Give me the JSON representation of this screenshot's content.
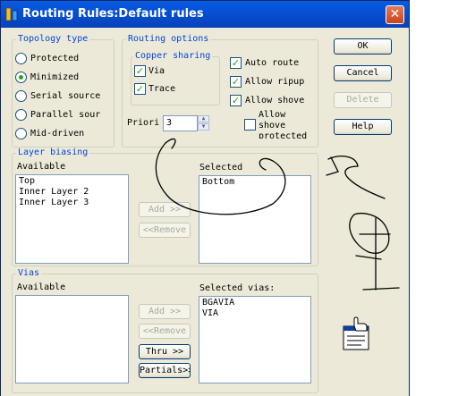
{
  "window": {
    "title": "Routing Rules:Default rules",
    "close_glyph": "✕"
  },
  "topology": {
    "title": "Topology type",
    "options": [
      {
        "label": "Protected",
        "selected": false
      },
      {
        "label": "Minimized",
        "selected": true
      },
      {
        "label": "Serial source",
        "selected": false
      },
      {
        "label": "Parallel sour",
        "selected": false
      },
      {
        "label": "Mid-driven",
        "selected": false
      }
    ]
  },
  "routing_options": {
    "title": "Routing options",
    "copper_sharing": {
      "title": "Copper sharing",
      "via": {
        "label": "Via",
        "checked": true
      },
      "trace": {
        "label": "Trace",
        "checked": true
      }
    },
    "auto_route": {
      "label": "Auto route",
      "checked": true
    },
    "allow_ripup": {
      "label": "Allow ripup",
      "checked": true
    },
    "allow_shove": {
      "label": "Allow shove",
      "checked": true
    },
    "allow_shove_protected": {
      "label_line1": "Allow",
      "label_line2": "shove",
      "label_line3": "protected",
      "checked": false
    },
    "priority": {
      "label": "Priori",
      "value": "3"
    }
  },
  "buttons": {
    "ok": "OK",
    "cancel": "Cancel",
    "delete": "Delete",
    "help": "Help"
  },
  "layer_biasing": {
    "title": "Layer biasing",
    "available_label": "Available",
    "available": [
      "Top",
      "Inner Layer 2",
      "Inner Layer 3"
    ],
    "selected_label": "Selected",
    "selected": [
      "Bottom"
    ],
    "add": "Add >>",
    "remove": "<<Remove"
  },
  "vias": {
    "title": "Vias",
    "available_label": "Available",
    "available": [],
    "selected_label": "Selected vias:",
    "selected": [
      "BGAVIA",
      "VIA"
    ],
    "add": "Add >>",
    "remove": "<<Remove",
    "thru": "Thru >>",
    "partials": "Partials>>"
  },
  "icons": {
    "help_pointer": "help-pointer-icon"
  },
  "colors": {
    "group_title": "#0046d5",
    "check_mark": "#21a121",
    "title_bar": "#0551d8"
  }
}
